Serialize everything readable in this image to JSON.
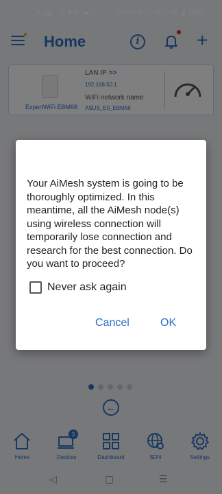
{
  "status_bar": {
    "time": "7:48",
    "notif_icons": "⚠ ▮ in ☁ •",
    "net_speed": "54.0 KB/S",
    "network": "Vo LTE",
    "battery": "90%"
  },
  "header": {
    "title": "Home"
  },
  "device_card": {
    "device_name": "ExpertWiFi EBM68",
    "lan_ip_label": "LAN IP",
    "lan_ip_chevron": ">>",
    "lan_ip": "192.168.50.1",
    "wifi_label": "WiFi network name",
    "wifi_name": "ASUS_E0_EBM68"
  },
  "dialog": {
    "message": "Your AiMesh system is going to be thoroughly optimized. In this meantime, all the AiMesh node(s) using wireless connection will temporarily lose connection and research for the best connection. Do you want to proceed?",
    "checkbox_label": "Never ask again",
    "checkbox_checked": false,
    "cancel_label": "Cancel",
    "ok_label": "OK"
  },
  "pager": {
    "page_count": 5,
    "active_index": 0
  },
  "bottom_nav": {
    "items": [
      {
        "label": "Home",
        "icon": "home-icon"
      },
      {
        "label": "Devices",
        "icon": "devices-icon",
        "badge": "3"
      },
      {
        "label": "Dashboard",
        "icon": "dashboard-icon"
      },
      {
        "label": "SDN",
        "icon": "sdn-icon"
      },
      {
        "label": "Settings",
        "icon": "settings-icon"
      }
    ]
  },
  "colors": {
    "accent": "#2b6fc5"
  }
}
